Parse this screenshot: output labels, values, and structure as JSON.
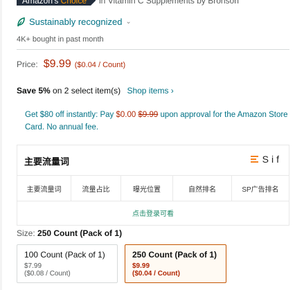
{
  "header": {
    "badge_prefix": "Amazon's",
    "badge_highlight": "Choice",
    "badge_category": "in Vitamin C Supplements by Bronson"
  },
  "sustainability": {
    "label": "Sustainably recognized",
    "icon": "leaf-icon"
  },
  "bought": "4K+ bought in past month",
  "price": {
    "label": "Price:",
    "value": "$9.99",
    "unit": "($0.04 / Count)"
  },
  "save": {
    "bold": "Save 5%",
    "text": "on 2 select item(s)",
    "link": "Shop items ›"
  },
  "promo": {
    "part1": "Get $80 off instantly: Pay",
    "pay": "$0.00",
    "strike": "$9.99",
    "part2": "upon approval for the Amazon Store Card. No annual fee."
  },
  "panel": {
    "title": "主要流量词",
    "brand": "Sif",
    "columns": [
      "主要流量词",
      "流量占比",
      "曝光位置",
      "自然排名",
      "SP广告排名"
    ],
    "login_text": "点击登录可看"
  },
  "size": {
    "label": "Size:",
    "value": "250 Count (Pack of 1)"
  },
  "options": [
    {
      "name": "100 Count (Pack of 1)",
      "price": "$7.99",
      "unit": "($0.08 / Count)",
      "selected": false
    },
    {
      "name": "250 Count (Pack of 1)",
      "price": "$9.99",
      "unit": "($0.04 / Count)",
      "selected": true
    }
  ],
  "colors": {
    "price_red": "#b12704",
    "link_teal": "#007185",
    "selected_border": "#c45500",
    "sif_orange": "#f58220"
  }
}
